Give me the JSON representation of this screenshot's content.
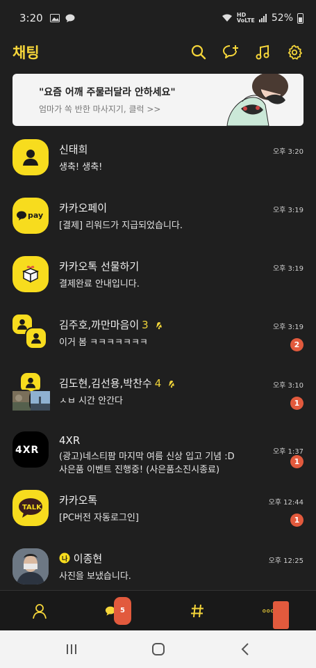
{
  "status_bar": {
    "time": "3:20",
    "battery": "52%"
  },
  "header": {
    "title": "채팅"
  },
  "banner": {
    "headline": "\"요즘 어깨 주물러달라 안하세요\"",
    "subtext": "엄마가 쏙 반한 마사지기, 클럭 >>"
  },
  "chats": [
    {
      "name": "신태희",
      "message": "생축! 생축!",
      "time": "오후 3:20",
      "badge": ""
    },
    {
      "name": "카카오페이",
      "message": "[결제] 리워드가 지급되었습니다.",
      "time": "오후 3:19",
      "badge": ""
    },
    {
      "name": "카카오톡 선물하기",
      "message": "결제완료 안내입니다.",
      "time": "오후 3:19",
      "badge": ""
    },
    {
      "name": "김주호,까만마음이",
      "count": "3",
      "message": "이거 봄 ㅋㅋㅋㅋㅋㅋㅋ",
      "time": "오후 3:19",
      "badge": "2"
    },
    {
      "name": "김도현,김선용,박찬수",
      "count": "4",
      "message": "ㅅㅂ 시간 안간다",
      "time": "오후 3:10",
      "badge": "1"
    },
    {
      "name": "4XR",
      "message": "(광고)네스티팜 마지막 여름 신상 입고 기념 :D",
      "message2": "사은품 이벤트 진행중! (사은품소진시종료)",
      "time": "오후 1:37",
      "badge": "1"
    },
    {
      "name": "카카오톡",
      "message": "[PC버전 자동로그인]",
      "time": "오후 12:44",
      "badge": "1"
    },
    {
      "name": "이종현",
      "message": "사진을 보냈습니다.",
      "time": "오후 12:25",
      "badge": ""
    }
  ],
  "bottom_nav": {
    "chat_badge": "5"
  },
  "icons": [
    "search-icon",
    "new-chat-icon",
    "music-icon",
    "settings-icon",
    "person-icon",
    "chat-bubble-icon",
    "hashtag-icon",
    "more-icon"
  ],
  "colors": {
    "accent": "#f6d63a",
    "background": "#1f1f1f",
    "badge": "#e25a3d"
  }
}
